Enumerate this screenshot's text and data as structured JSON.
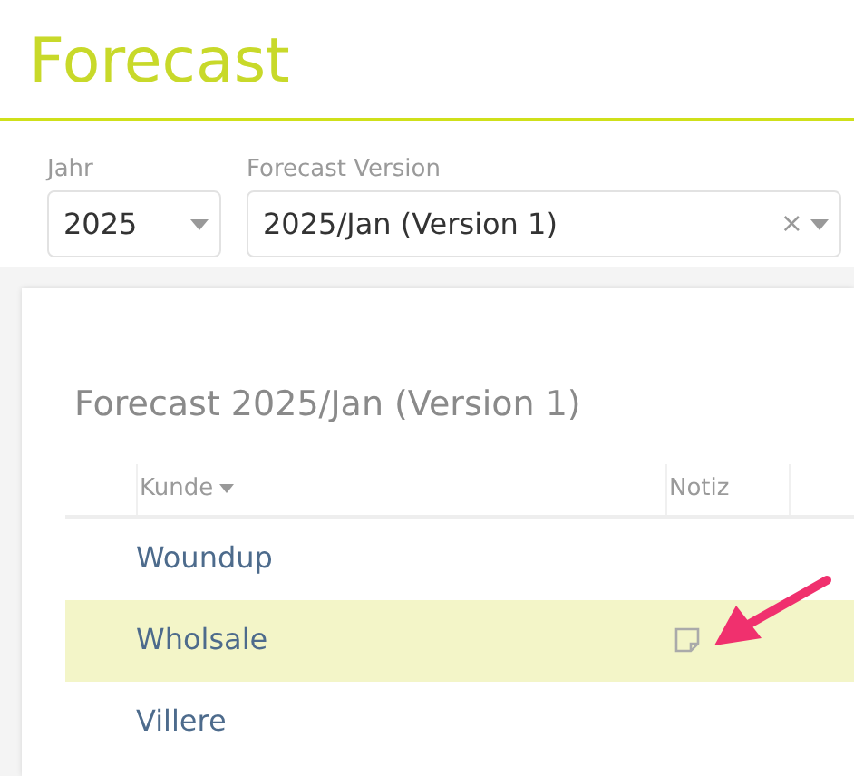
{
  "page_title": "Forecast",
  "filters": [
    {
      "label": "Jahr",
      "value": "2025"
    },
    {
      "label": "Forecast Version",
      "value": "2025/Jan (Version 1)",
      "clear_glyph": "×"
    }
  ],
  "table": {
    "title": "Forecast 2025/Jan (Version 1)",
    "columns": [
      {
        "label": "Kunde",
        "sorted": true
      },
      {
        "label": "Notiz",
        "sorted": false
      }
    ],
    "rows": [
      {
        "kunde": "Woundup",
        "has_note": false,
        "selected": false
      },
      {
        "kunde": "Wholsale",
        "has_note": true,
        "selected": true
      },
      {
        "kunde": "Villere",
        "has_note": false,
        "selected": false
      }
    ]
  }
}
